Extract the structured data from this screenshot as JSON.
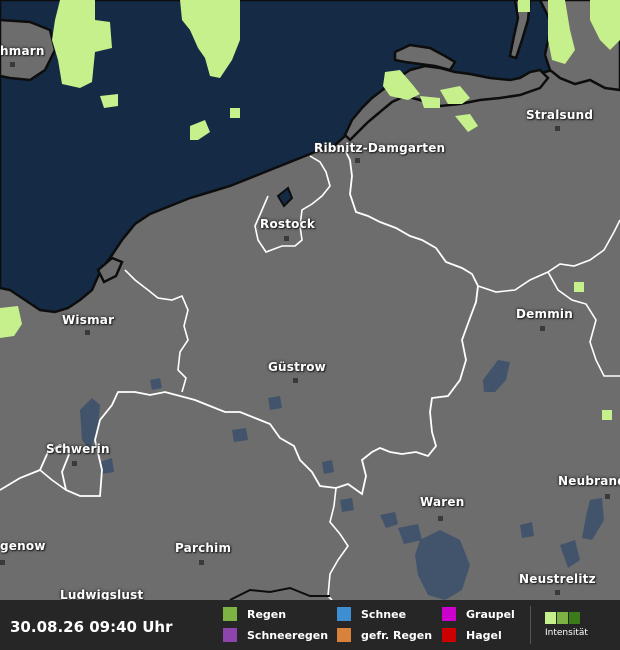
{
  "timestamp": "30.08.26 09:40 Uhr",
  "cities": [
    {
      "name": "hmarn"
    },
    {
      "name": "Stralsund"
    },
    {
      "name": "Ribnitz-Damgarten"
    },
    {
      "name": "Rostock"
    },
    {
      "name": "Wismar"
    },
    {
      "name": "Demmin"
    },
    {
      "name": "Güstrow"
    },
    {
      "name": "Schwerin"
    },
    {
      "name": "Neubrand"
    },
    {
      "name": "Waren"
    },
    {
      "name": "genow"
    },
    {
      "name": "Parchim"
    },
    {
      "name": "Neustrelitz"
    },
    {
      "name": "Ludwigslust"
    }
  ],
  "legend": {
    "items": [
      {
        "label": "Regen",
        "color": "#7cb342"
      },
      {
        "label": "Schneeregen",
        "color": "#8e44ad"
      },
      {
        "label": "Schnee",
        "color": "#3d8fd1"
      },
      {
        "label": "gefr. Regen",
        "color": "#d9823b"
      },
      {
        "label": "Graupel",
        "color": "#cc00cc"
      },
      {
        "label": "Hagel",
        "color": "#cc0000"
      }
    ],
    "intensity_label": "Intensität",
    "intensity_colors": [
      "#c5f08c",
      "#7cb342",
      "#3d7a1a"
    ]
  },
  "colors": {
    "land": "#6d6d6d",
    "sea": "#142a45",
    "lake": "#41546b",
    "rain_light": "#c5f08c",
    "border": "#ffffff"
  }
}
